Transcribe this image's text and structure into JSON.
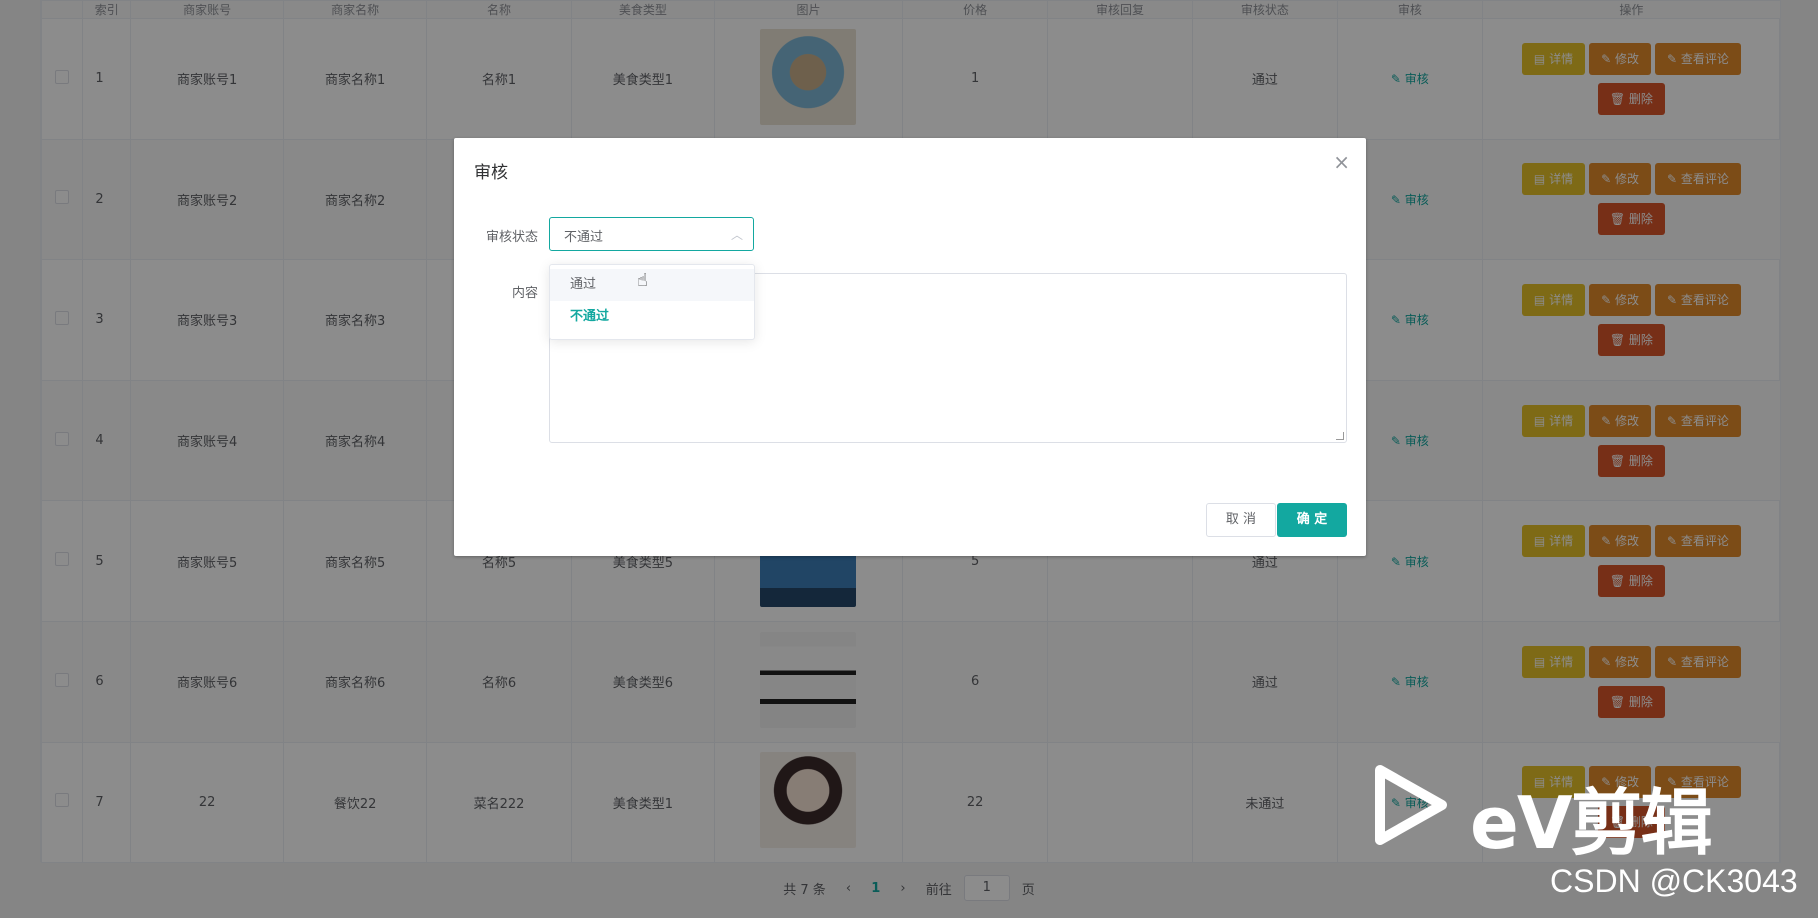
{
  "table": {
    "headers": [
      "",
      "索引",
      "商家账号",
      "商家名称",
      "名称",
      "美食类型",
      "图片",
      "价格",
      "审核回复",
      "审核状态",
      "审核",
      "操作"
    ],
    "rows": [
      {
        "idx": "1",
        "account": "商家账号1",
        "merchant": "商家名称1",
        "name": "名称1",
        "type": "美食类型1",
        "price": "1",
        "status": "通过"
      },
      {
        "idx": "2",
        "account": "商家账号2",
        "merchant": "商家名称2",
        "name": "",
        "type": "",
        "price": "",
        "status": ""
      },
      {
        "idx": "3",
        "account": "商家账号3",
        "merchant": "商家名称3",
        "name": "",
        "type": "",
        "price": "",
        "status": ""
      },
      {
        "idx": "4",
        "account": "商家账号4",
        "merchant": "商家名称4",
        "name": "",
        "type": "",
        "price": "",
        "status": ""
      },
      {
        "idx": "5",
        "account": "商家账号5",
        "merchant": "商家名称5",
        "name": "名称5",
        "type": "美食类型5",
        "price": "5",
        "status": "通过"
      },
      {
        "idx": "6",
        "account": "商家账号6",
        "merchant": "商家名称6",
        "name": "名称6",
        "type": "美食类型6",
        "price": "6",
        "status": "通过"
      },
      {
        "idx": "7",
        "account": "22",
        "merchant": "餐饮22",
        "name": "菜名222",
        "type": "美食类型1",
        "price": "22",
        "status": "未通过"
      }
    ],
    "audit_link": "审核",
    "ops": {
      "detail": "详情",
      "edit": "修改",
      "review": "查看评论",
      "delete": "删除"
    }
  },
  "pager": {
    "total": "共 7 条",
    "current": "1",
    "goto_prefix": "前往",
    "goto_value": "1",
    "goto_suffix": "页"
  },
  "dialog": {
    "title": "审核",
    "status_label": "审核状态",
    "status_value": "不通过",
    "content_label": "内容",
    "cancel": "取 消",
    "confirm": "确 定",
    "options": [
      "通过",
      "不通过"
    ]
  },
  "watermark": {
    "brand": "eV剪辑",
    "csdn": "CSDN @CK3043"
  },
  "colors": {
    "accent": "#13a8a0",
    "detail": "#e6c229",
    "edit": "#e28a2b",
    "delete": "#d9562a"
  }
}
